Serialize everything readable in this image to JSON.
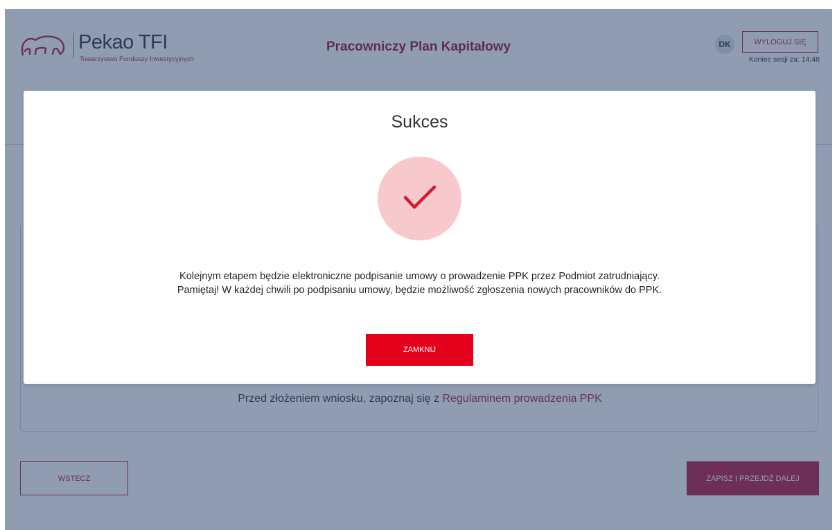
{
  "header": {
    "logo_name": "Pekao TFI",
    "logo_subtitle": "Towarzystwo Funduszy Inwestycyjnych",
    "app_title": "Pracowniczy Plan Kapitałowy",
    "user_initials": "DK",
    "logout_label": "WYLOGUJ SIĘ",
    "session_label": "Koniec sesji za: 14:48"
  },
  "main": {
    "regulations_text": "Przed złożeniem wniosku, zapoznaj się z",
    "regulations_link": "Regulaminem prowadzenia PPK"
  },
  "footer": {
    "back_label": "WSTECZ",
    "next_label": "ZAPISZ I PRZEJDŹ DALEJ"
  },
  "modal": {
    "title": "Sukces",
    "icon": "check-icon",
    "message_line1": "Kolejnym etapem będzie elektroniczne podpisanie umowy o prowadzenie PPK przez Podmiot zatrudniający.",
    "message_line2": "Pamiętaj! W każdej chwili po podpisaniu umowy, będzie możliwość zgłoszenia nowych pracowników do PPK.",
    "close_label": "ZAMKNIJ"
  },
  "colors": {
    "brand": "#b32646",
    "primary_button": "#e2001a",
    "overlay": "#223a66",
    "success_circle": "#f8c9cc"
  }
}
